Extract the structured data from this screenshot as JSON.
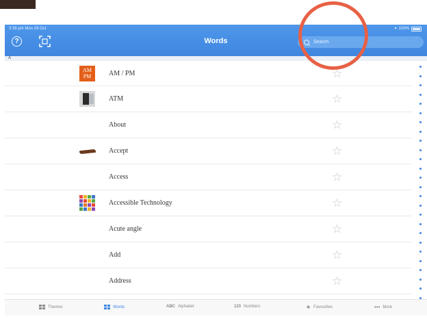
{
  "status_bar": {
    "time": "3:36 pm  Mon 29 Oct",
    "battery": "100%"
  },
  "header": {
    "title": "Words",
    "search_placeholder": "Search",
    "help_symbol": "?"
  },
  "section": {
    "letter": "A"
  },
  "words": [
    {
      "label": "AM / PM",
      "thumb": "ampm",
      "thumb_text_1": "AM",
      "thumb_text_2": "PM",
      "favourite": false
    },
    {
      "label": "ATM",
      "thumb": "atm",
      "favourite": false
    },
    {
      "label": "About",
      "thumb": "none",
      "favourite": false
    },
    {
      "label": "Accept",
      "thumb": "accept",
      "favourite": false
    },
    {
      "label": "Access",
      "thumb": "none",
      "favourite": false
    },
    {
      "label": "Accessible Technology",
      "thumb": "acctech",
      "favourite": false
    },
    {
      "label": "Acute angle",
      "thumb": "none",
      "favourite": false
    },
    {
      "label": "Add",
      "thumb": "none",
      "favourite": false
    },
    {
      "label": "Address",
      "thumb": "none",
      "favourite": false
    }
  ],
  "tabs": [
    {
      "label": "Themes",
      "icon": "grid-icon",
      "active": false
    },
    {
      "label": "Words",
      "icon": "grid-icon",
      "active": true
    },
    {
      "label": "Alphabet",
      "icon_text": "ABC",
      "active": false
    },
    {
      "label": "Numbers",
      "icon_text": "123",
      "active": false
    },
    {
      "label": "Favourites",
      "icon": "star-icon",
      "active": false
    },
    {
      "label": "More",
      "icon_text": "•••",
      "active": false
    }
  ],
  "colors": {
    "header_blue": "#3f86e0",
    "annotation_circle": "#e86145",
    "index_blue": "#3a82e0"
  }
}
